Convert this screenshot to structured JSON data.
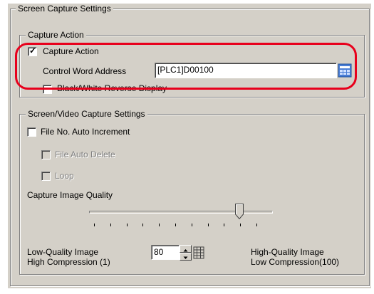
{
  "screen_capture_settings": {
    "legend": "Screen Capture Settings",
    "capture_action_group": {
      "legend": "Capture Action",
      "capture_action_checkbox": {
        "label": "Capture Action",
        "checked": true
      },
      "control_word_address": {
        "label": "Control Word Address",
        "value": "[PLC1]D00100"
      },
      "bw_reverse_checkbox": {
        "label": "Black/White Reverse Display",
        "checked": false
      }
    },
    "screen_video_group": {
      "legend": "Screen/Video Capture Settings",
      "file_no_auto_increment": {
        "label": "File No. Auto Increment",
        "checked": false
      },
      "file_auto_delete": {
        "label": "File Auto Delete",
        "checked": false,
        "enabled": false
      },
      "loop": {
        "label": "Loop",
        "checked": false,
        "enabled": false
      },
      "capture_image_quality": {
        "label": "Capture Image Quality",
        "value": 80,
        "min": 1,
        "max": 100,
        "low_label_line1": "Low-Quality Image",
        "low_label_line2": "High Compression (1)",
        "high_label_line1": "High-Quality Image",
        "high_label_line2": "Low Compression(100)"
      }
    }
  },
  "colors": {
    "highlight": "#e8001c",
    "panel": "#d4d0c8"
  }
}
